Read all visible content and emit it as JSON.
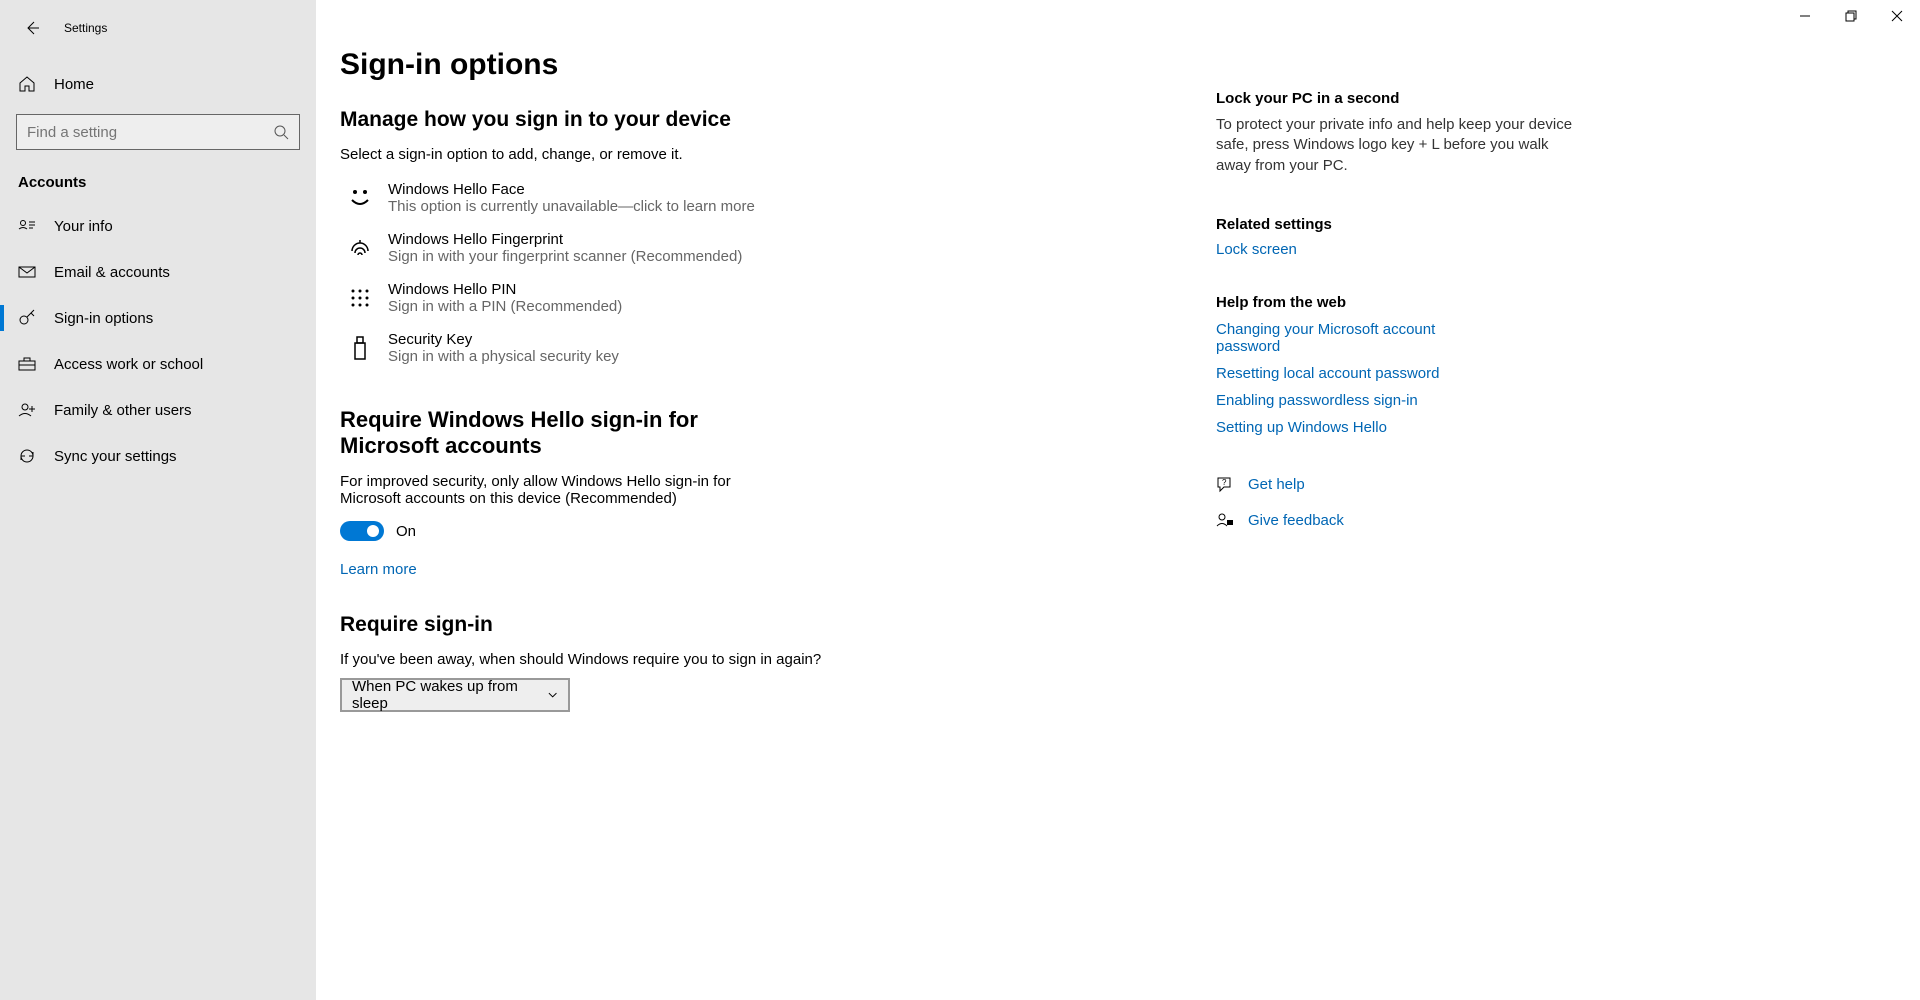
{
  "window": {
    "title": "Settings"
  },
  "sidebar": {
    "home": "Home",
    "search_placeholder": "Find a setting",
    "category": "Accounts",
    "items": [
      {
        "label": "Your info"
      },
      {
        "label": "Email & accounts"
      },
      {
        "label": "Sign-in options"
      },
      {
        "label": "Access work or school"
      },
      {
        "label": "Family & other users"
      },
      {
        "label": "Sync your settings"
      }
    ]
  },
  "page": {
    "title": "Sign-in options",
    "manage": {
      "heading": "Manage how you sign in to your device",
      "desc": "Select a sign-in option to add, change, or remove it.",
      "options": [
        {
          "title": "Windows Hello Face",
          "sub": "This option is currently unavailable—click to learn more"
        },
        {
          "title": "Windows Hello Fingerprint",
          "sub": "Sign in with your fingerprint scanner (Recommended)"
        },
        {
          "title": "Windows Hello PIN",
          "sub": "Sign in with a PIN (Recommended)"
        },
        {
          "title": "Security Key",
          "sub": "Sign in with a physical security key"
        }
      ]
    },
    "require_hello": {
      "heading": "Require Windows Hello sign-in for Microsoft accounts",
      "desc": "For improved security, only allow Windows Hello sign-in for Microsoft accounts on this device (Recommended)",
      "state": "On",
      "learn": "Learn more"
    },
    "require_signin": {
      "heading": "Require sign-in",
      "desc": "If you've been away, when should Windows require you to sign in again?",
      "value": "When PC wakes up from sleep"
    }
  },
  "rightpane": {
    "lock": {
      "title": "Lock your PC in a second",
      "text": "To protect your private info and help keep your device safe, press Windows logo key + L before you walk away from your PC."
    },
    "related": {
      "title": "Related settings",
      "links": [
        "Lock screen"
      ]
    },
    "help": {
      "title": "Help from the web",
      "links": [
        "Changing your Microsoft account password",
        "Resetting local account password",
        "Enabling passwordless sign-in",
        "Setting up Windows Hello"
      ]
    },
    "actions": {
      "help": "Get help",
      "feedback": "Give feedback"
    }
  }
}
